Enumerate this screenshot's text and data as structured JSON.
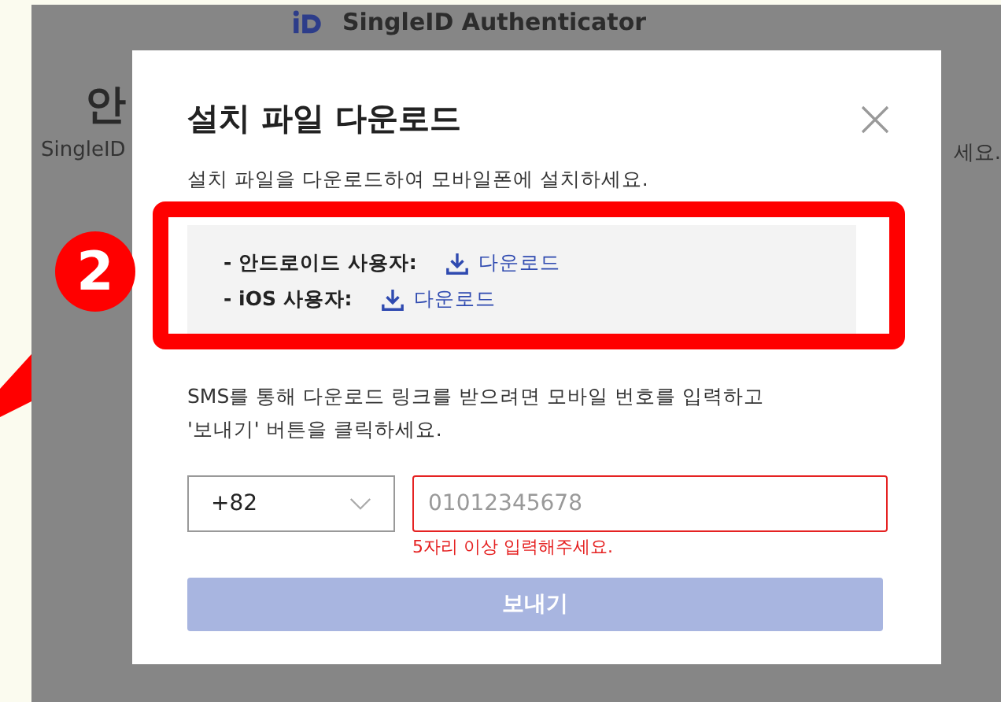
{
  "background_page": {
    "header_title": "SingleID Authenticator",
    "heading": "안",
    "text_left": "SingleID",
    "text_right": "세요."
  },
  "modal": {
    "title": "설치 파일 다운로드",
    "description": "설치 파일을 다운로드하여 모바일폰에 설치하세요.",
    "downloads": [
      {
        "label": "- 안드로이드 사용자:",
        "link": "다운로드"
      },
      {
        "label": "- iOS 사용자:",
        "link": "다운로드"
      }
    ],
    "sms_instruction": "SMS를 통해 다운로드 링크를 받으려면 모바일 번호를 입력하고\n'보내기' 버튼을 클릭하세요.",
    "country_code": {
      "value": "+82"
    },
    "phone": {
      "placeholder": "01012345678",
      "invalid": true,
      "error": "5자리 이상 입력해주세요."
    },
    "send_button": {
      "label": "보내기",
      "disabled": true
    }
  },
  "annotation": {
    "badge": "2"
  }
}
